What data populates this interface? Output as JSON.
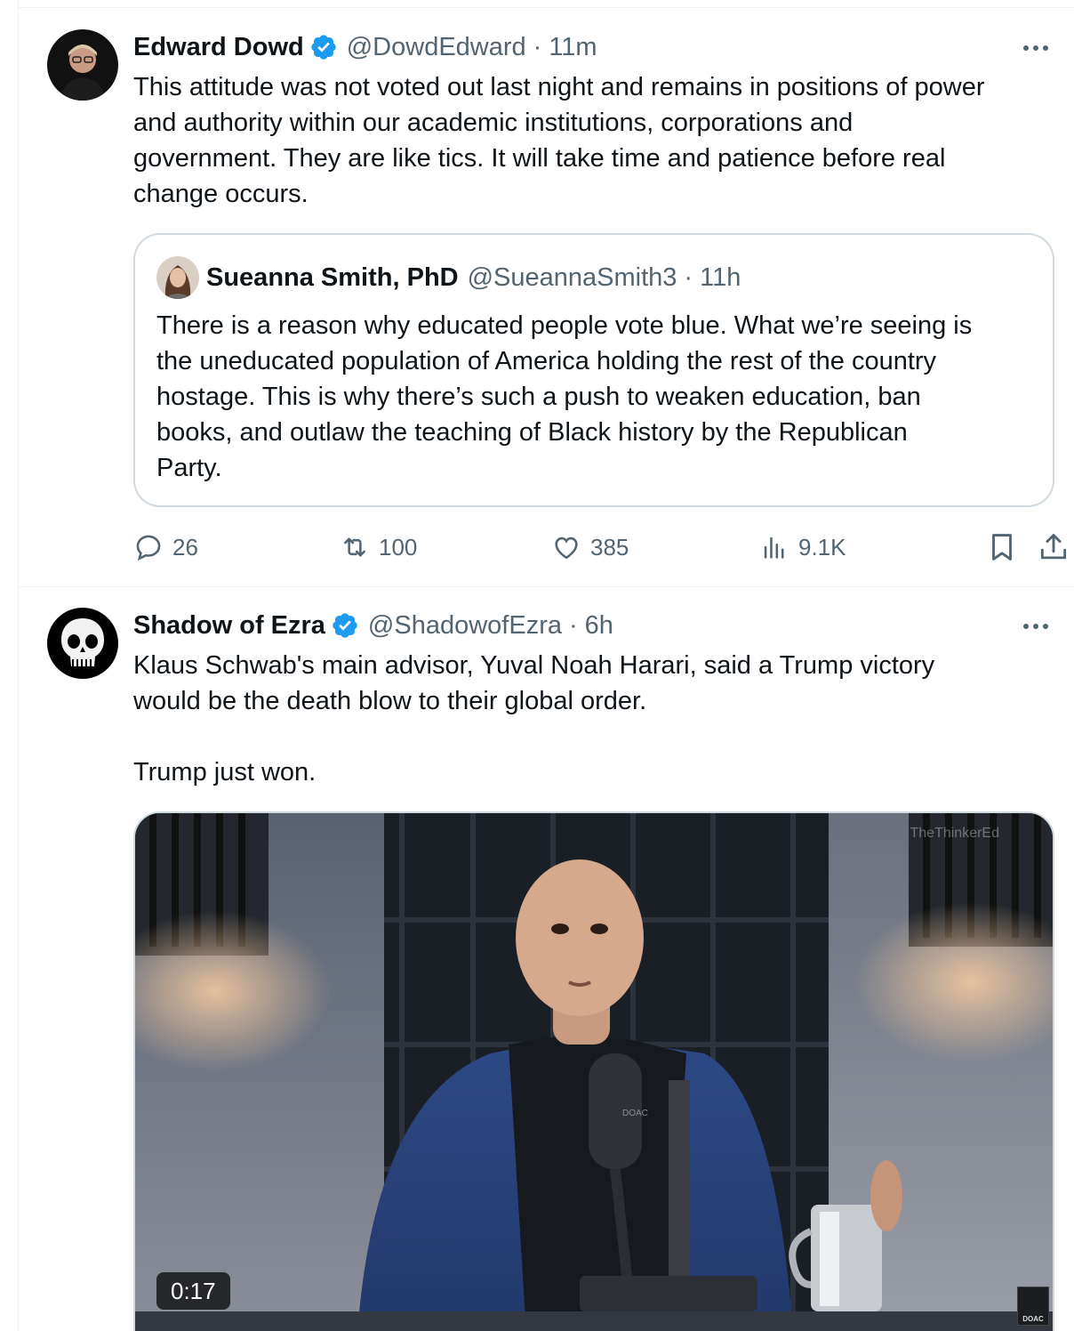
{
  "tweets": [
    {
      "name": "Edward Dowd",
      "handle": "@DowdEdward",
      "time": "11m",
      "text": "This attitude was not voted out last night and remains in positions of power\nand authority within our academic institutions, corporations and\ngovernment. They are like tics. It will take time and patience before real\nchange occurs.",
      "quote": {
        "name": "Sueanna Smith, PhD",
        "handle": "@SueannaSmith3",
        "time": "11h",
        "text": "There is a reason why educated people vote blue. What we’re seeing is\nthe uneducated population of America holding the rest of the country\nhostage. This is why there’s such a push to weaken education, ban\nbooks, and outlaw the teaching of Black history by the Republican\nParty."
      },
      "stats": {
        "replies": "26",
        "reposts": "100",
        "likes": "385",
        "views": "9.1K"
      }
    },
    {
      "name": "Shadow of Ezra",
      "handle": "@ShadowofEzra",
      "time": "6h",
      "text": "Klaus Schwab's main advisor, Yuval Noah Harari, said a Trump victory\nwould be the death blow to their global order.\n\nTrump just won.",
      "media": {
        "duration": "0:17",
        "watermark": "TheThinkerEd",
        "mic_label": "DOAC",
        "corner_label": "DOAC"
      }
    }
  ],
  "separator": "·",
  "icons": {
    "verified": "verified-badge-icon",
    "more": "more-dots-icon",
    "reply": "reply-icon",
    "repost": "repost-icon",
    "like": "heart-icon",
    "views": "views-chart-icon",
    "bookmark": "bookmark-icon",
    "share": "share-icon"
  },
  "colors": {
    "text": "#0f1419",
    "secondary": "#536471",
    "verified": "#1d9bf0",
    "border": "#cfd9de"
  }
}
